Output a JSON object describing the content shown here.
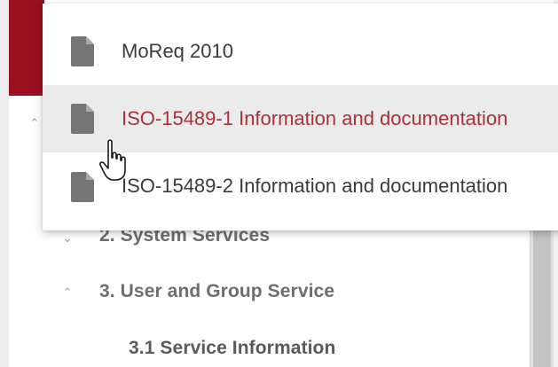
{
  "dropdown": {
    "items": [
      {
        "label": "MoReq 2010",
        "icon": "document-icon",
        "state": "normal"
      },
      {
        "label": "ISO-15489-1 Information and documentation",
        "icon": "document-icon",
        "state": "hover"
      },
      {
        "label": "ISO-15489-2 Information and documentation",
        "icon": "document-icon",
        "state": "normal"
      }
    ]
  },
  "tree": {
    "items": [
      {
        "label": "2. System Services",
        "chevron": "chevron-down-icon"
      },
      {
        "label": "3. User and Group Service",
        "chevron": "chevron-up-icon"
      },
      {
        "label": "3.1 Service Information",
        "chevron": ""
      }
    ]
  },
  "colors": {
    "brand": "#9b0f1f",
    "hover_text": "#a83238",
    "hover_bg": "#ebebeb",
    "icon": "#757575"
  },
  "cursor": "hand-pointer-icon"
}
